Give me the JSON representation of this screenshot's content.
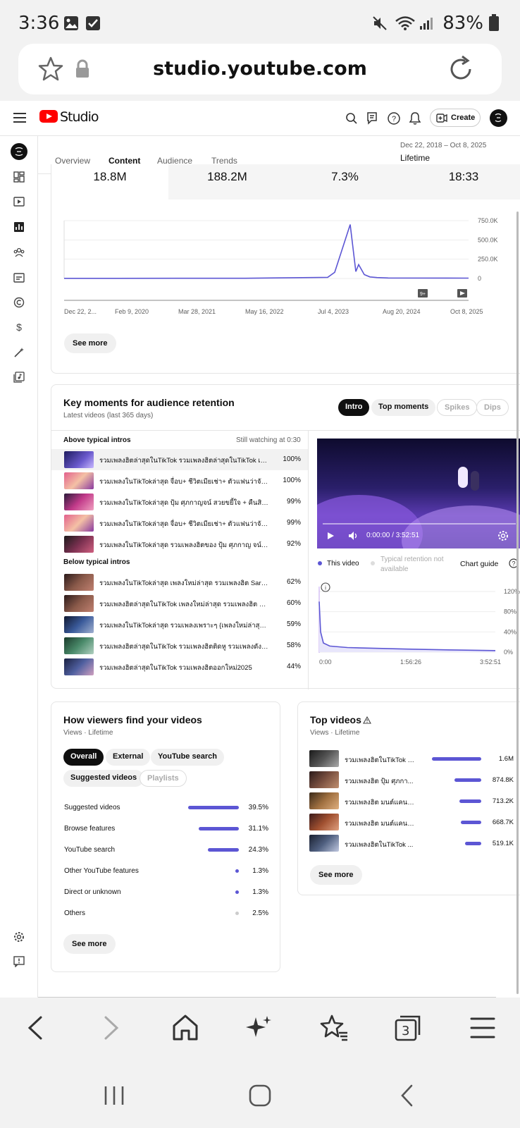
{
  "status_bar": {
    "time": "3:36",
    "battery": "83%"
  },
  "browser": {
    "url": "studio.youtube.com",
    "tabs_count": "3"
  },
  "header": {
    "studio_label": "Studio",
    "create_label": "Create"
  },
  "analytics_tabs": [
    "Overview",
    "Content",
    "Audience",
    "Trends"
  ],
  "date_range": {
    "range": "Dec 22, 2018 – Oct 8, 2025",
    "label": "Lifetime"
  },
  "metrics": [
    "18.8M",
    "188.2M",
    "7.3%",
    "18:33"
  ],
  "views_chart": {
    "y_ticks": [
      "750.0K",
      "500.0K",
      "250.0K",
      "0"
    ],
    "x_ticks": [
      "Dec 22, 2...",
      "Feb 9, 2020",
      "Mar 28, 2021",
      "May 16, 2022",
      "Jul 4, 2023",
      "Aug 20, 2024",
      "Oct 8, 2025"
    ],
    "see_more": "See more"
  },
  "chart_data": [
    {
      "type": "line",
      "title": "",
      "x": [
        "Dec 22, 2018",
        "Feb 9, 2020",
        "Mar 28, 2021",
        "May 16, 2022",
        "Jan 2023",
        "Apr 2023",
        "Jun 2023",
        "Jul 2023",
        "Aug 2023",
        "Sep 2023",
        "Nov 2023",
        "Jan 2024",
        "Mar 2024",
        "Aug 20, 2024",
        "Oct 8, 2025"
      ],
      "series": [
        {
          "values": [
            2000,
            2000,
            2500,
            3000,
            15000,
            80000,
            700000,
            90000,
            180000,
            50000,
            20000,
            12000,
            8000,
            6000,
            5000
          ]
        }
      ],
      "ylim": [
        0,
        750000
      ]
    },
    {
      "type": "line",
      "title": "",
      "x": [
        "0:00",
        "1:56:26",
        "3:52:51"
      ],
      "series": [
        {
          "name": "This video",
          "values": [
            100,
            10,
            3
          ]
        }
      ],
      "ylim": [
        0,
        120
      ]
    }
  ],
  "retention": {
    "title": "Key moments for audience retention",
    "subtitle": "Latest videos (last 365 days)",
    "filters": [
      "Intro",
      "Top moments",
      "Spikes",
      "Dips"
    ],
    "above_label": "Above typical intros",
    "still_watching": "Still watching at 0:30",
    "below_label": "Below typical intros",
    "above": [
      {
        "title": "รวมเพลงฮิตล่าสุดในTikTok รวมเพลงฮิตล่าสุดในTikTok เพ...",
        "pct": "100%"
      },
      {
        "title": "รวมเพลงในTikTokล่าสุด จื่อบ+ ชีวิตเมียเช่า+ ตัวแฟนว่าจังไ...",
        "pct": "100%"
      },
      {
        "title": "รวมเพลงในTikTokล่าสุด ปุ้ม ศุภกาญจน์ สวยขยี้ใจ + คืนสิทธิ์ ...",
        "pct": "99%"
      },
      {
        "title": "รวมเพลงในTikTokล่าสุด จื่อบ+ ชีวิตเมียเช่า+ ตัวแฟนว่าจังได้...",
        "pct": "99%"
      },
      {
        "title": "รวมเพลงในTikTokล่าสุด รวมเพลงฮิตของ ปุ้ม ศุภกาญ จน์ เพ...",
        "pct": "92%"
      }
    ],
    "below": [
      {
        "title": "รวมเพลงในTikTokล่าสุด เพลงใหม่ล่าสุด รวมเพลงฮิต Saran ...",
        "pct": "62%"
      },
      {
        "title": "รวมเพลงฮิตล่าสุดในTikTok เพลงใหม่ล่าสุด รวมเพลงฮิต Sara...",
        "pct": "60%"
      },
      {
        "title": "รวมเพลงในTikTokล่าสุด รวมเพลงเพราะๆ {เพลงใหม่ล่าสุด 20...",
        "pct": "59%"
      },
      {
        "title": "รวมเพลงฮิตล่าสุดในTikTok รวมเพลงฮิตติดหู รวมเพลงดังในT...",
        "pct": "58%"
      },
      {
        "title": "รวมเพลงฮิตล่าสุดในTikTok รวมเพลงฮิตออกใหม่2025",
        "pct": "44%"
      }
    ],
    "player_time": "0:00:00 / 3:52:51",
    "legend_this": "This video",
    "legend_typical": "Typical retention not available",
    "chart_guide": "Chart guide",
    "ret_y_ticks": [
      "120%",
      "80%",
      "40%",
      "0%"
    ],
    "ret_x_ticks": [
      "0:00",
      "1:56:26",
      "3:52:51"
    ]
  },
  "traffic": {
    "title": "How viewers find your videos",
    "subtitle": "Views · Lifetime",
    "filters": [
      "Overall",
      "External",
      "YouTube search",
      "Suggested videos",
      "Playlists"
    ],
    "rows": [
      {
        "label": "Suggested videos",
        "value": "39.5%",
        "pct": 39.5
      },
      {
        "label": "Browse features",
        "value": "31.1%",
        "pct": 31.1
      },
      {
        "label": "YouTube search",
        "value": "24.3%",
        "pct": 24.3
      },
      {
        "label": "Other YouTube features",
        "value": "1.3%",
        "pct": 1.3
      },
      {
        "label": "Direct or unknown",
        "value": "1.3%",
        "pct": 1.3
      },
      {
        "label": "Others",
        "value": "2.5%",
        "pct": 2.5
      }
    ],
    "see_more": "See more"
  },
  "top_videos": {
    "title": "Top videos",
    "subtitle": "Views · Lifetime",
    "rows": [
      {
        "title": "รวมเพลงฮิตในTikTok [...",
        "value": "1.6M",
        "num": 1600000
      },
      {
        "title": "รวมเพลงฮิต ปุ้ม ศุภกา...",
        "value": "874.8K",
        "num": 874800
      },
      {
        "title": "รวมเพลงฮิต มนต์แคน แ...",
        "value": "713.2K",
        "num": 713200
      },
      {
        "title": "รวมเพลงฮิต มนต์แคน แ...",
        "value": "668.7K",
        "num": 668700
      },
      {
        "title": "รวมเพลงฮิตในTikTok ...",
        "value": "519.1K",
        "num": 519100
      }
    ],
    "see_more": "See more"
  },
  "colors": {
    "accent": "#5c56d4",
    "youtube_red": "#ff0000"
  }
}
